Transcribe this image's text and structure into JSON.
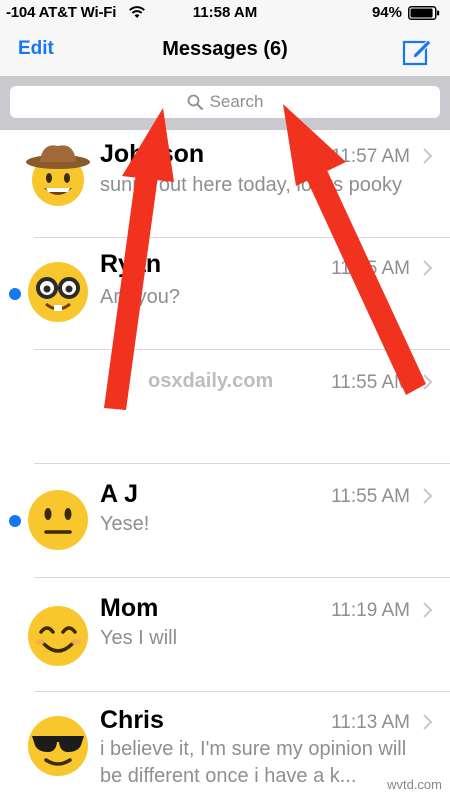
{
  "status_bar": {
    "carrier": "-104 AT&T Wi-Fi",
    "time": "11:58 AM",
    "battery": "94%",
    "battery_level": 0.94
  },
  "nav": {
    "edit_label": "Edit",
    "title": "Messages (6)",
    "accent": "#1477f5"
  },
  "search": {
    "placeholder": "Search"
  },
  "conversations": [
    {
      "sender": "Johnson",
      "time": "11:57 AM",
      "preview": "sunny out here today, looks pooky",
      "unread": false,
      "avatar": "cowboy-emoji"
    },
    {
      "sender": "Ryan",
      "time": "11:55 AM",
      "preview": "Are you?",
      "unread": true,
      "avatar": "nerd-emoji"
    },
    {
      "sender": "",
      "time": "11:55 AM",
      "preview": "",
      "unread": false,
      "avatar": "none"
    },
    {
      "sender": "A J",
      "time": "11:55 AM",
      "preview": "Yese!",
      "unread": true,
      "avatar": "neutral-emoji"
    },
    {
      "sender": "Mom",
      "time": "11:19 AM",
      "preview": "Yes I will",
      "unread": false,
      "avatar": "smile-emoji"
    },
    {
      "sender": "Chris",
      "time": "11:13 AM",
      "preview": "i believe it, I'm sure my opinion will be different once i have a k...",
      "unread": false,
      "avatar": "sunglasses-emoji"
    }
  ],
  "watermarks": {
    "center": "osxdaily.com",
    "corner": "wvtd.com"
  },
  "annotation_color": "#f0321f"
}
